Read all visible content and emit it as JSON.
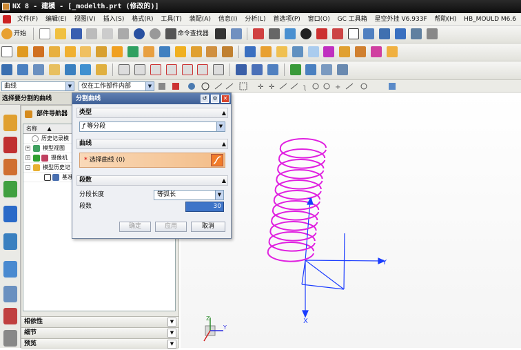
{
  "window": {
    "title": "NX 8 - 建模 - [_modelth.prt (修改的)]"
  },
  "menu": [
    "文件(F)",
    "编辑(E)",
    "视图(V)",
    "插入(S)",
    "格式(R)",
    "工具(T)",
    "装配(A)",
    "信息(I)",
    "分析(L)",
    "首选项(P)",
    "窗口(O)",
    "GC 工具箱",
    "星空外挂 V6.933F",
    "帮助(H)",
    "HB_MOULD M6.6"
  ],
  "toolbar1": {
    "start_label": "开始",
    "cmd_finder_label": "命令查找器"
  },
  "filterbar": {
    "type_filter": "曲线",
    "scope_filter": "仅在工作部件内部"
  },
  "cue_line": "选择要分割的曲线",
  "navigator": {
    "title": "部件导航器",
    "col_name": "名称",
    "rows": [
      {
        "label": "历史记录模",
        "expander": ""
      },
      {
        "label": "模型视图",
        "expander": "+"
      },
      {
        "label": "摄像机",
        "expander": "+"
      },
      {
        "label": "模型历史记",
        "expander": "-"
      },
      {
        "label": "基准",
        "expander": ""
      }
    ],
    "accordions": [
      "相依性",
      "细节",
      "预览"
    ]
  },
  "dialog": {
    "title": "分割曲线",
    "section_type": "类型",
    "type_value": "等分段",
    "section_curve": "曲线",
    "select_curve": "选择曲线 (0)",
    "section_segments": "段数",
    "seg_length_label": "分段长度",
    "seg_length_value": "等弧长",
    "seg_count_label": "段数",
    "seg_count_value": "30",
    "btn_ok": "确定",
    "btn_apply": "应用",
    "btn_cancel": "取消"
  },
  "axes": {
    "x": "X",
    "y": "Y",
    "z": "Z"
  },
  "colors": {
    "helix": "#e020e0",
    "axis": "#1a3cff",
    "title_bg": "#3e5f96",
    "select_bg": "#f3bd88"
  }
}
